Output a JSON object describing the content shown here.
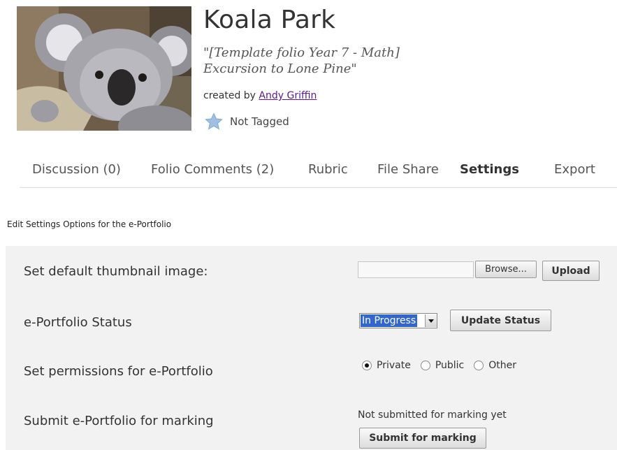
{
  "header": {
    "title": "Koala Park",
    "subtitle": "\"[Template folio Year 7 - Math] Excursion to Lone Pine\"",
    "created_by_prefix": "created by",
    "author": "Andy Griffin",
    "tag_status": "Not Tagged",
    "thumbnail_icon": "koala-photo"
  },
  "tabs": [
    {
      "label": "Discussion (0)",
      "active": false
    },
    {
      "label": "Folio Comments (2)",
      "active": false
    },
    {
      "label": "Rubric",
      "active": false
    },
    {
      "label": "File Share",
      "active": false
    },
    {
      "label": "Settings",
      "active": true
    },
    {
      "label": "Export",
      "active": false
    }
  ],
  "page_heading": "Edit Settings Options for the e-Portfolio",
  "settings": {
    "thumbnail": {
      "label": "Set default thumbnail image:",
      "browse_label": "Browse...",
      "upload_label": "Upload",
      "file_value": ""
    },
    "status": {
      "label": "e-Portfolio Status",
      "selected": "In Progress",
      "update_label": "Update Status"
    },
    "permissions": {
      "label": "Set permissions for e-Portfolio",
      "options": [
        {
          "label": "Private",
          "checked": true
        },
        {
          "label": "Public",
          "checked": false
        },
        {
          "label": "Other",
          "checked": false
        }
      ]
    },
    "marking": {
      "label": "Submit e-Portfolio for marking",
      "status_text": "Not submitted for marking yet",
      "submit_label": "Submit for marking"
    }
  },
  "colors": {
    "link": "#5b1a8a",
    "panel_bg": "#f2f2f2",
    "select_highlight": "#3366cc",
    "star": "#9fc0e0"
  }
}
